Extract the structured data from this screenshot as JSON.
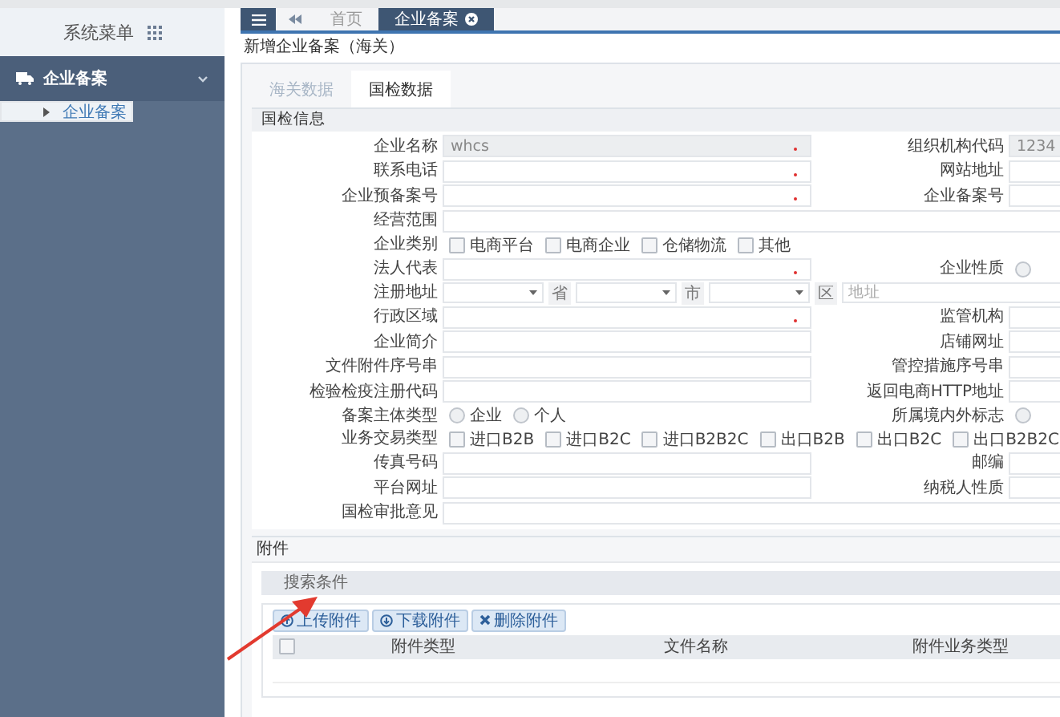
{
  "sidebar": {
    "title": "系统菜单",
    "groups": [
      {
        "label": "企业备案",
        "expanded": true,
        "children": [
          {
            "label": "企业备案",
            "selected": true
          }
        ]
      }
    ]
  },
  "tabbar": {
    "tabs": [
      {
        "label": "首页",
        "selected": false
      },
      {
        "label": "企业备案",
        "selected": true
      }
    ]
  },
  "page_title": "新增企业备案（海关）",
  "sub_tabs": [
    {
      "label": "海关数据",
      "selected": false
    },
    {
      "label": "国检数据",
      "selected": true
    }
  ],
  "section_title": "国检信息",
  "rows": [
    {
      "cells": [
        {
          "kind": "text",
          "label": "企业名称",
          "value": "whcs",
          "required": true,
          "disabled": true
        },
        {
          "kind": "text",
          "label": "组织机构代码",
          "value": "1234",
          "required": false,
          "disabled": true
        }
      ]
    },
    {
      "cells": [
        {
          "kind": "text",
          "label": "联系电话",
          "required": true,
          "disabled": false
        },
        {
          "kind": "text",
          "label": "网站地址",
          "required": false,
          "disabled": false
        }
      ]
    },
    {
      "cells": [
        {
          "kind": "text",
          "label": "企业预备案号",
          "required": true,
          "disabled": false
        },
        {
          "kind": "text",
          "label": "企业备案号",
          "required": false,
          "disabled": false
        }
      ]
    },
    {
      "cells": [
        {
          "kind": "text",
          "label": "经营范围",
          "required": false,
          "disabled": false
        }
      ]
    },
    {
      "cells": [
        {
          "kind": "checks",
          "label": "企业类别",
          "options": [
            {
              "label": "电商平台",
              "checked": false
            },
            {
              "label": "电商企业",
              "checked": false
            },
            {
              "label": "仓储物流",
              "checked": false
            },
            {
              "label": "其他",
              "checked": false
            }
          ]
        }
      ]
    },
    {
      "cells": [
        {
          "kind": "text",
          "label": "法人代表",
          "required": true,
          "disabled": false
        },
        {
          "kind": "radios",
          "label": "企业性质",
          "options": [
            {
              "selected": false
            }
          ]
        }
      ]
    },
    {
      "cells": [
        {
          "kind": "address",
          "label": "注册地址",
          "parts": [
            {
              "unit": "省"
            },
            {
              "unit": "市"
            },
            {
              "unit": "区"
            }
          ],
          "placeholder": "地址"
        }
      ]
    },
    {
      "cells": [
        {
          "kind": "text",
          "label": "行政区域",
          "required": true,
          "disabled": false
        },
        {
          "kind": "text",
          "label": "监管机构",
          "required": false,
          "disabled": false
        }
      ]
    },
    {
      "cells": [
        {
          "kind": "text",
          "label": "企业简介",
          "required": false,
          "disabled": false
        },
        {
          "kind": "text",
          "label": "店铺网址",
          "required": false,
          "disabled": false
        }
      ]
    },
    {
      "cells": [
        {
          "kind": "text",
          "label": "文件附件序号串",
          "required": false,
          "disabled": false
        },
        {
          "kind": "text",
          "label": "管控措施序号串",
          "required": false,
          "disabled": false
        }
      ]
    },
    {
      "cells": [
        {
          "kind": "text",
          "label": "检验检疫注册代码",
          "required": false,
          "disabled": false
        },
        {
          "kind": "text",
          "label": "返回电商HTTP地址",
          "required": false,
          "disabled": false
        }
      ]
    },
    {
      "cells": [
        {
          "kind": "radios",
          "label": "备案主体类型",
          "options": [
            {
              "label": "企业",
              "selected": false
            },
            {
              "label": "个人",
              "selected": false
            }
          ]
        },
        {
          "kind": "radios",
          "label": "所属境内外标志",
          "options": [
            {
              "selected": false
            }
          ]
        }
      ]
    },
    {
      "cells": [
        {
          "kind": "checks",
          "label": "业务交易类型",
          "options": [
            {
              "label": "进口B2B",
              "checked": false
            },
            {
              "label": "进口B2C",
              "checked": false
            },
            {
              "label": "进口B2B2C",
              "checked": false
            },
            {
              "label": "出口B2B",
              "checked": false
            },
            {
              "label": "出口B2C",
              "checked": false
            },
            {
              "label": "出口B2B2C",
              "checked": false
            }
          ]
        }
      ]
    },
    {
      "cells": [
        {
          "kind": "text",
          "label": "传真号码",
          "required": false,
          "disabled": false
        },
        {
          "kind": "text",
          "label": "邮编",
          "required": false,
          "disabled": false
        }
      ]
    },
    {
      "cells": [
        {
          "kind": "text",
          "label": "平台网址",
          "required": false,
          "disabled": false
        },
        {
          "kind": "text",
          "label": "纳税人性质",
          "required": false,
          "disabled": false
        }
      ]
    },
    {
      "cells": [
        {
          "kind": "text",
          "label": "国检审批意见",
          "required": false,
          "disabled": false
        }
      ]
    }
  ],
  "attachments": {
    "title": "附件",
    "search_title": "搜索条件",
    "buttons": [
      {
        "kind": "upload",
        "label": "上传附件"
      },
      {
        "kind": "download",
        "label": "下载附件"
      },
      {
        "kind": "delete",
        "label": "删除附件"
      }
    ],
    "select_all": {
      "checked": false
    },
    "columns": [
      "附件类型",
      "文件名称",
      "附件业务类型"
    ]
  }
}
